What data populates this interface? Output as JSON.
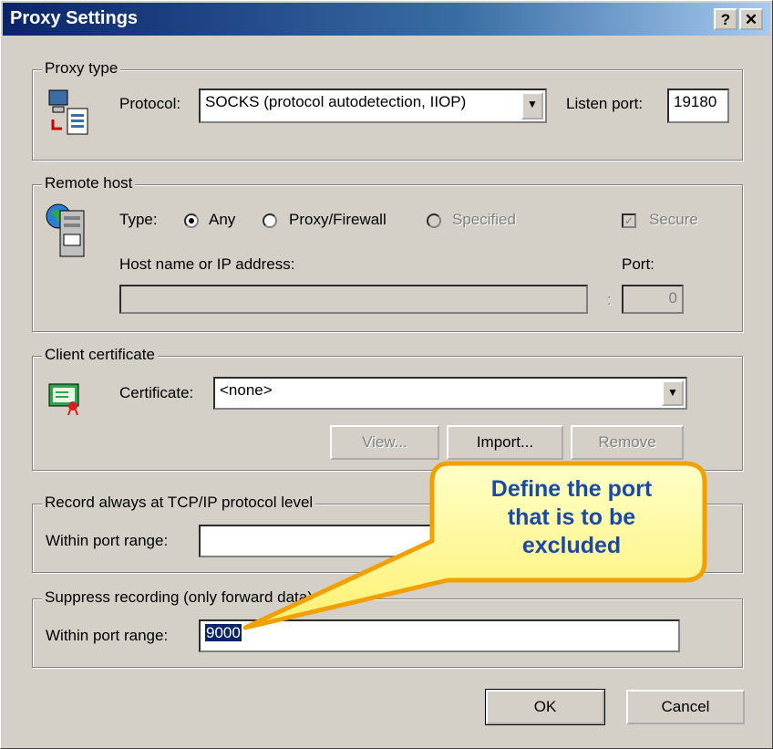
{
  "window": {
    "title": "Proxy Settings",
    "help_label": "?",
    "close_label": "✕"
  },
  "proxy_type": {
    "legend": "Proxy type",
    "protocol_label": "Protocol:",
    "protocol_value": "SOCKS (protocol autodetection, IIOP)",
    "listen_port_label": "Listen port:",
    "listen_port_value": "19180"
  },
  "remote_host": {
    "legend": "Remote host",
    "type_label": "Type:",
    "options": [
      {
        "label": "Any",
        "checked": true,
        "enabled": true
      },
      {
        "label": "Proxy/Firewall",
        "checked": false,
        "enabled": true
      },
      {
        "label": "Specified",
        "checked": false,
        "enabled": false
      }
    ],
    "secure_label": "Secure",
    "host_label": "Host name or IP address:",
    "host_value": "",
    "port_label": "Port:",
    "port_value": "0",
    "colon": ":"
  },
  "client_certificate": {
    "legend": "Client certificate",
    "certificate_label": "Certificate:",
    "certificate_value": "<none>",
    "view_label": "View...",
    "import_label": "Import...",
    "remove_label": "Remove"
  },
  "record_always": {
    "legend": "Record always at TCP/IP protocol level",
    "port_range_label": "Within port range:",
    "port_range_value": ""
  },
  "suppress": {
    "legend": "Suppress recording (only forward data)",
    "port_range_label": "Within port range:",
    "port_range_value": "9000"
  },
  "buttons": {
    "ok": "OK",
    "cancel": "Cancel"
  },
  "callout": {
    "lines": [
      "Define the port",
      "that is to be",
      "excluded"
    ],
    "color": "#1a4aa8",
    "fill": "#fff8a0",
    "border": "#f0a000"
  }
}
